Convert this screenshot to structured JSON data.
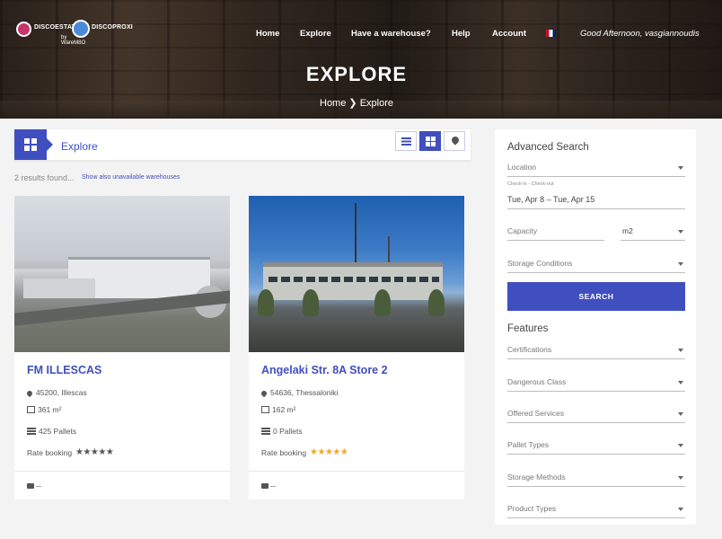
{
  "brand": {
    "name1": "DISCOESTATE",
    "name2": "DISCOPROXI",
    "by": "by WareM8O"
  },
  "nav": {
    "items": [
      "Home",
      "Explore",
      "Have a warehouse?",
      "Help",
      "Account"
    ],
    "greeting": "Good Afternoon, vasgiannoudis"
  },
  "hero": {
    "title": "EXPLORE",
    "crumb_home": "Home",
    "crumb_sep": "❯",
    "crumb_current": "Explore"
  },
  "explore": {
    "label": "Explore",
    "results": "2 results found...",
    "show_link": "Show also unavailable warehouses",
    "view_active": "grid"
  },
  "cards": [
    {
      "title": "FM ILLESCAS",
      "location": "45200, Illescas",
      "area": "361 m²",
      "pallets": "425 Pallets",
      "rate_label": "Rate booking",
      "stars": "★★★★★",
      "star_color": "#555555",
      "footer": "--"
    },
    {
      "title": "Angelaki Str. 8A Store 2",
      "location": "54636, Thessaloniki",
      "area": "162 m²",
      "pallets": "0 Pallets",
      "rate_label": "Rate booking",
      "stars": "★★★★★",
      "star_color": "#f0a722",
      "footer": "--"
    }
  ],
  "sidebar": {
    "title": "Advanced Search",
    "location": "Location",
    "checkin_label": "Check-in - Check-out",
    "dates": "Tue, Apr 8 – Tue, Apr 15",
    "capacity": "Capacity",
    "unit": "m2",
    "storage_conditions": "Storage Conditions",
    "search": "SEARCH",
    "features_title": "Features",
    "features": [
      "Certifications",
      "Dangerous Class",
      "Offered Services",
      "Pallet Types",
      "Storage Methods",
      "Product Types"
    ]
  },
  "colors": {
    "accent": "#3f4fbf",
    "star_gold": "#f0a722"
  }
}
